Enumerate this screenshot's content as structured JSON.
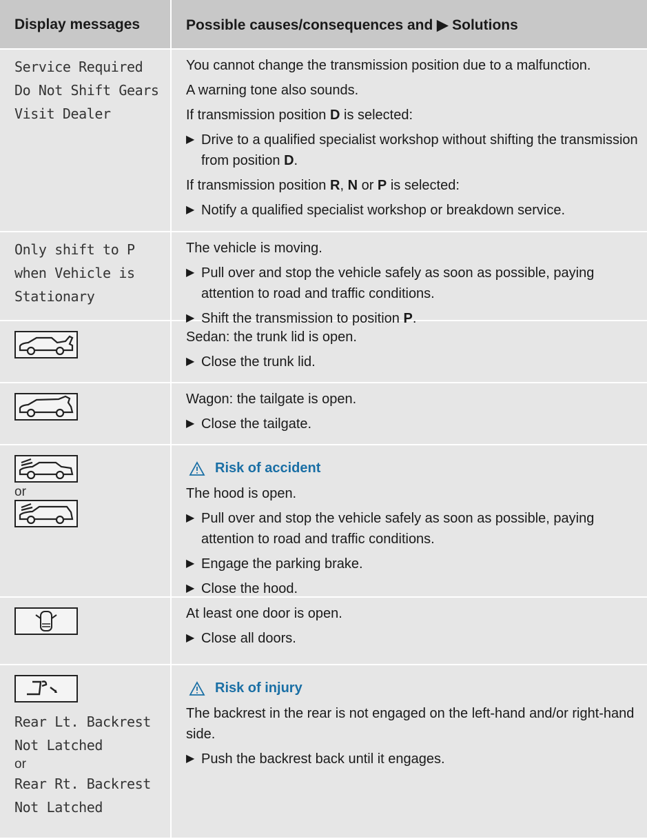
{
  "header": {
    "col1": "Display messages",
    "col2": "Possible causes/consequences and ▶ Solutions"
  },
  "rows": [
    {
      "msg": [
        "Service Required",
        "Do Not Shift Gears",
        "Visit Dealer"
      ],
      "para1": "You cannot change the transmission position due to a malfunction.",
      "para2": "A warning tone also sounds.",
      "para3_pre": "If transmission position ",
      "para3_b": "D",
      "para3_post": " is selected:",
      "step1_pre": "Drive to a qualified specialist workshop without shifting the transmission from position ",
      "step1_b": "D",
      "step1_post": ".",
      "para4_pre": "If transmission position ",
      "para4_b1": "R",
      "para4_sep1": ", ",
      "para4_b2": "N",
      "para4_sep2": " or ",
      "para4_b3": "P",
      "para4_post": " is selected:",
      "step2": "Notify a qualified specialist workshop or breakdown service."
    },
    {
      "msg": [
        "Only shift to P",
        "when Vehicle is",
        "Stationary"
      ],
      "para1": "The vehicle is moving.",
      "step1": "Pull over and stop the vehicle safely as soon as possible, paying attention to road and traffic conditions.",
      "step2_pre": "Shift the transmission to position ",
      "step2_b": "P",
      "step2_post": "."
    },
    {
      "icon": "sedan-trunk-open-icon",
      "para1": "Sedan: the trunk lid is open.",
      "step1": "Close the trunk lid."
    },
    {
      "icon": "wagon-tailgate-open-icon",
      "para1": "Wagon: the tailgate is open.",
      "step1": "Close the tailgate."
    },
    {
      "icon1": "sedan-hood-open-icon",
      "or": "or",
      "icon2": "wagon-hood-open-icon",
      "warning": "Risk of accident",
      "para1": "The hood is open.",
      "step1": "Pull over and stop the vehicle safely as soon as possible, paying attention to road and traffic conditions.",
      "step2": "Engage the parking brake.",
      "step3": "Close the hood."
    },
    {
      "icon": "door-open-icon",
      "para1": "At least one door is open.",
      "step1": "Close all doors."
    },
    {
      "icon": "rear-backrest-icon",
      "msg1": [
        "Rear Lt. Backrest",
        "Not Latched"
      ],
      "or": "or",
      "msg2": [
        "Rear Rt. Backrest",
        "Not Latched"
      ],
      "warning": "Risk of injury",
      "para1": "The backrest in the rear is not engaged on the left-hand and/or right-hand side.",
      "step1": "Push the backrest back until it engages."
    }
  ],
  "colors": {
    "header_bg": "#c8c8c8",
    "cell_bg": "#e6e6e6",
    "warning": "#1a6fa5"
  }
}
